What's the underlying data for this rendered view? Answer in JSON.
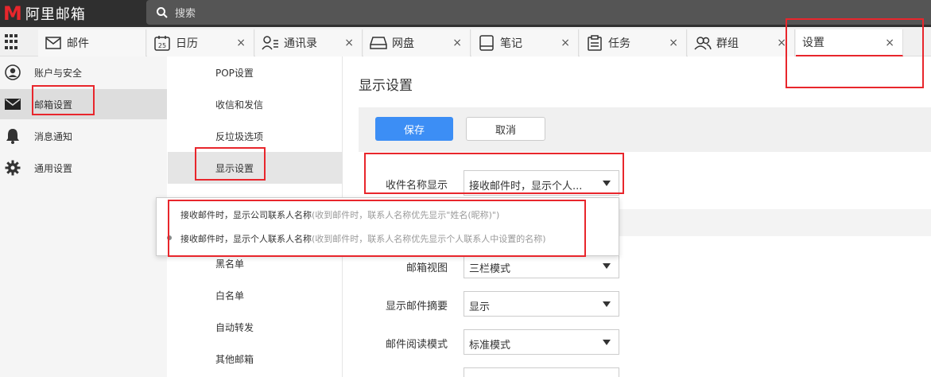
{
  "app": {
    "logo_letter": "M",
    "logo_name": "阿里邮箱",
    "brand_color": "#e8262c"
  },
  "search": {
    "placeholder": "搜索"
  },
  "tabs": [
    {
      "label": "邮件",
      "icon": "mail-icon",
      "closable": false
    },
    {
      "label": "日历",
      "icon": "calendar-icon",
      "icon_text": "25",
      "closable": true
    },
    {
      "label": "通讯录",
      "icon": "contacts-icon",
      "closable": true
    },
    {
      "label": "网盘",
      "icon": "drive-icon",
      "closable": true
    },
    {
      "label": "笔记",
      "icon": "notes-icon",
      "closable": true
    },
    {
      "label": "任务",
      "icon": "tasks-icon",
      "closable": true
    },
    {
      "label": "群组",
      "icon": "group-icon",
      "closable": true
    },
    {
      "label": "设置",
      "icon": "",
      "closable": true,
      "active": true
    }
  ],
  "close_glyph": "×",
  "sidebar": {
    "items": [
      {
        "label": "账户与安全",
        "icon": "account-icon"
      },
      {
        "label": "邮箱设置",
        "icon": "mail-icon",
        "active": true
      },
      {
        "label": "消息通知",
        "icon": "bell-icon"
      },
      {
        "label": "通用设置",
        "icon": "gear-icon"
      }
    ]
  },
  "submenu": {
    "items": [
      {
        "label": "POP设置"
      },
      {
        "label": "收信和发信"
      },
      {
        "label": "反垃圾选项"
      },
      {
        "label": "显示设置",
        "active": true
      },
      {
        "label": "黑名单"
      },
      {
        "label": "白名单"
      },
      {
        "label": "自动转发"
      },
      {
        "label": "其他邮箱"
      }
    ]
  },
  "main": {
    "title": "显示设置",
    "save_label": "保存",
    "cancel_label": "取消",
    "accent_color": "#3c8ef5",
    "fields": [
      {
        "label": "收件名称显示",
        "value": "接收邮件时，显示个人..."
      },
      {
        "label": "邮箱视图",
        "value": "三栏模式"
      },
      {
        "label": "显示邮件摘要",
        "value": "显示"
      },
      {
        "label": "邮件阅读模式",
        "value": "标准模式"
      }
    ]
  },
  "dropdown": {
    "options": [
      {
        "text": "接收邮件时，显示公司联系人名称",
        "hint": "(收到邮件时，联系人名称优先显示\"姓名(昵称)\")",
        "selected": false
      },
      {
        "text": "接收邮件时，显示个人联系人名称",
        "hint": "(收到邮件时，联系人名称优先显示个人联系人中设置的名称)",
        "selected": true
      }
    ]
  }
}
